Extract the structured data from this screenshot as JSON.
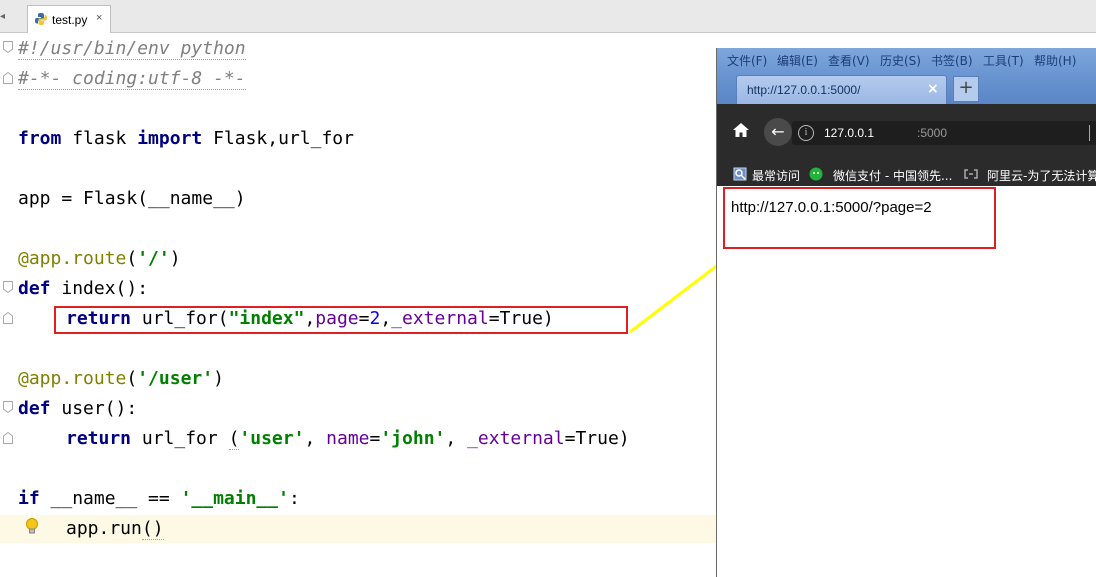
{
  "ide": {
    "tab_scroll_icon": "tab-scroll-left-icon",
    "tab": {
      "name": "test.py",
      "close": "×"
    },
    "code": {
      "l1": "#!/usr/bin/env python",
      "l2": "#-*- coding:utf-8 -*-",
      "l3_kw1": "from",
      "l3_t1": " flask ",
      "l3_kw2": "import",
      "l3_t2": " Flask,url_for",
      "l4_t1": "app = Flask(",
      "l4_t2": "__name__",
      "l4_t3": ")",
      "l5_dec": "@app.route",
      "l5_t1": "(",
      "l5_st": "'/'",
      "l5_t2": ")",
      "l6_kw": "def",
      "l6_t": " index():",
      "l7_kw": "return",
      "l7_t1": " url_for(",
      "l7_st": "\"index\"",
      "l7_t2": ",",
      "l7_p1": "page",
      "l7_t3": "=",
      "l7_num": "2",
      "l7_t4": ",",
      "l7_p2": "_external",
      "l7_t5": "=True)",
      "l8_dec": "@app.route",
      "l8_t1": "(",
      "l8_st": "'/user'",
      "l8_t2": ")",
      "l9_kw": "def",
      "l9_t": " user():",
      "l10_kw": "return",
      "l10_t1": " url_for ",
      "l10_t2": "(",
      "l10_st1": "'user'",
      "l10_t3": ", ",
      "l10_p1": "name",
      "l10_t4": "=",
      "l10_st2": "'john'",
      "l10_t5": ", ",
      "l10_p2": "_external",
      "l10_t6": "=True)",
      "l11_kw": "if",
      "l11_t1": " __name__ == ",
      "l11_st": "'__main__'",
      "l11_t2": ":",
      "l12_t1": "app.run",
      "l12_t2": "()"
    }
  },
  "browser": {
    "menu": [
      "文件(F)",
      "编辑(E)",
      "查看(V)",
      "历史(S)",
      "书签(B)",
      "工具(T)",
      "帮助(H)"
    ],
    "tab_title": "http://127.0.0.1:5000/",
    "tab_close": "×",
    "new_tab": "+",
    "back": "←",
    "info": "i",
    "url_host": "127.0.0.1",
    "url_port": ":5000",
    "bookmarks": [
      "最常访问",
      "微信支付 - 中国领先...",
      "阿里云-为了无法计算"
    ],
    "page_text": "http://127.0.0.1:5000/?page=2"
  },
  "colors": {
    "keyword": "#000080",
    "string": "#008000",
    "decorator": "#808000",
    "param": "#660099",
    "number": "#0000ff",
    "highlight_box": "#e02020",
    "arrow": "#ffff00"
  }
}
